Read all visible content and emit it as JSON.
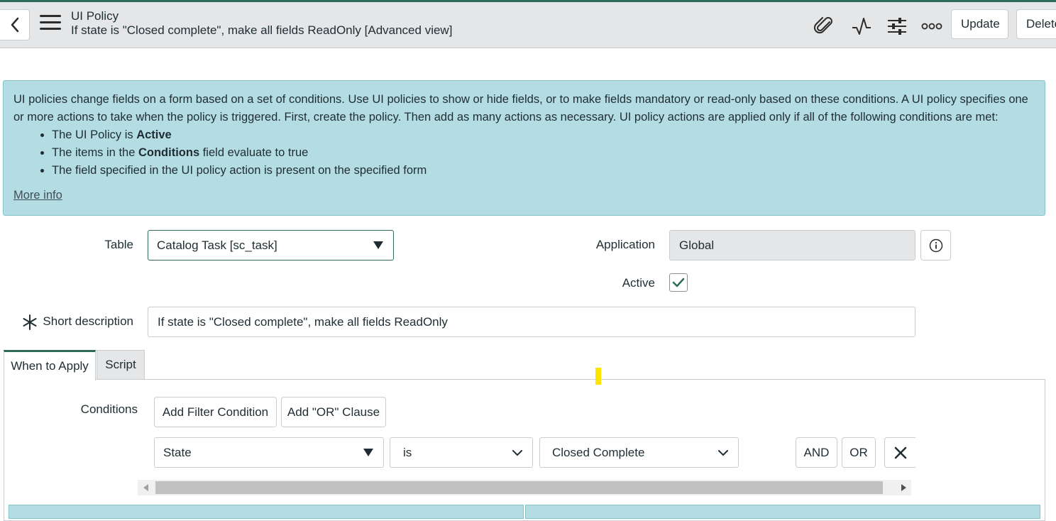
{
  "header": {
    "record_type": "UI Policy",
    "record_title": "If state is \"Closed complete\", make all fields ReadOnly [Advanced view]",
    "update_label": "Update",
    "delete_label": "Delete"
  },
  "info": {
    "paragraph": "UI policies change fields on a form based on a set of conditions. Use UI policies to show or hide fields, or to make fields mandatory or read-only based on these conditions. A UI policy specifies one or more actions to take when the policy is triggered. First, create the policy. Then add as many actions as necessary. UI policy actions are applied only if all of the following conditions are met:",
    "bullet1_prefix": "The UI Policy is ",
    "bullet1_bold": "Active",
    "bullet2_prefix": "The items in the ",
    "bullet2_bold": "Conditions",
    "bullet2_suffix": " field evaluate to true",
    "bullet3": "The field specified in the UI policy action is present on the specified form",
    "more_info": "More info"
  },
  "form": {
    "table_label": "Table",
    "table_value": "Catalog Task [sc_task]",
    "application_label": "Application",
    "application_value": "Global",
    "active_label": "Active",
    "active_checked": true,
    "short_desc_label": "Short description",
    "short_desc_value": "If state is \"Closed complete\", make all fields ReadOnly"
  },
  "tabs": {
    "when_to_apply": "When to Apply",
    "script": "Script"
  },
  "conditions": {
    "label": "Conditions",
    "add_filter": "Add Filter Condition",
    "add_or": "Add \"OR\" Clause",
    "field": "State",
    "operator": "is",
    "value": "Closed Complete",
    "and_label": "AND",
    "or_label": "OR"
  },
  "colors": {
    "accent": "#2e6b5b",
    "info_bg": "#b4dde3",
    "header_bg": "#e4e6e7"
  }
}
